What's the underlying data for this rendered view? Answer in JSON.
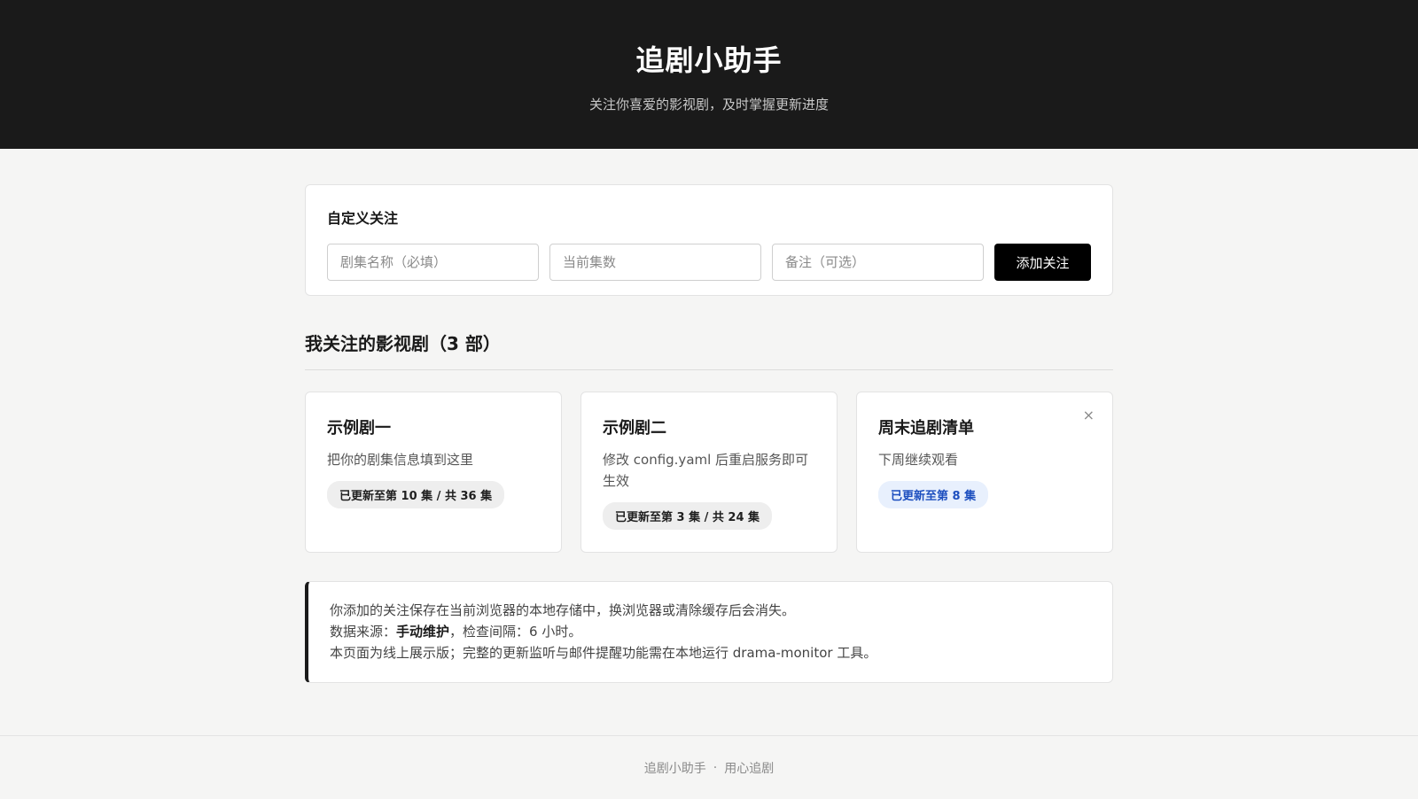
{
  "header": {
    "title": "追剧小助手",
    "subtitle": "关注你喜爱的影视剧，及时掌握更新进度"
  },
  "custom_follow": {
    "title": "自定义关注",
    "name_placeholder": "剧集名称（必填）",
    "episode_placeholder": "当前集数",
    "note_placeholder": "备注（可选）",
    "add_label": "添加关注"
  },
  "list": {
    "title": "我关注的影视剧（3 部）",
    "cards": [
      {
        "title": "示例剧一",
        "note": "把你的剧集信息填到这里",
        "badge": "已更新至第 10 集 / 共 36 集"
      },
      {
        "title": "示例剧二",
        "note": "修改 config.yaml 后重启服务即可生效",
        "badge": "已更新至第 3 集 / 共 24 集"
      },
      {
        "title": "周末追剧清单",
        "note": "下周继续观看",
        "badge": "已更新至第 8 集",
        "close": "×"
      }
    ]
  },
  "info": {
    "line1": "你添加的关注保存在当前浏览器的本地存储中，换浏览器或清除缓存后会消失。",
    "line2_prefix": "数据来源：",
    "line2_source": "手动维护",
    "line2_suffix": "，检查间隔：6 小时。",
    "line3": "本页面为线上展示版；完整的更新监听与邮件提醒功能需在本地运行 drama-monitor 工具。"
  },
  "footer": {
    "left": "追剧小助手",
    "dot": "·",
    "right": "用心追剧"
  },
  "colors": {
    "header_bg": "#1a1a1a",
    "accent_blue": "#1d4fbf",
    "button_bg": "#000000"
  }
}
